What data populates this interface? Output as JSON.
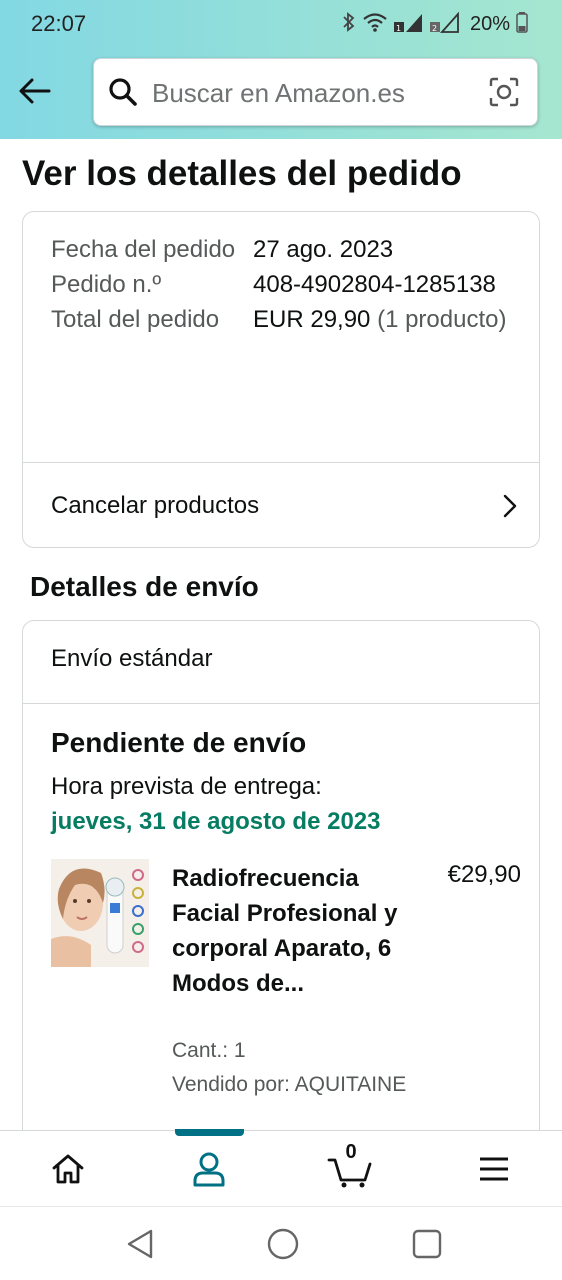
{
  "status_bar": {
    "time": "22:07",
    "battery": "20%"
  },
  "search": {
    "placeholder": "Buscar en Amazon.es"
  },
  "page": {
    "title": "Ver los detalles del pedido"
  },
  "order": {
    "date_label": "Fecha del pedido",
    "date_value": "27 ago. 2023",
    "number_label": "Pedido n.º",
    "number_value": "408-4902804-1285138",
    "total_label": "Total del pedido",
    "total_value": "EUR 29,90",
    "total_note": "(1 producto)",
    "cancel_label": "Cancelar productos"
  },
  "shipping": {
    "section_title": "Detalles de envío",
    "method": "Envío estándar",
    "status": "Pendiente de envío",
    "eta_label": "Hora prevista de entrega:",
    "eta_date": "jueves, 31 de agosto de 2023",
    "accent_color": "#067d62"
  },
  "product": {
    "name": "Radiofrecuencia Facial Profesional y corporal Aparato, 6 Modos de...",
    "price": "€29,90",
    "quantity": "Cant.: 1",
    "seller": "Vendido por: AQUITAINE"
  },
  "bottom_nav": {
    "items": [
      "home-icon",
      "account-icon",
      "cart-icon",
      "menu-icon"
    ],
    "active": "account-icon",
    "cart_count": "0",
    "active_color": "#007185"
  },
  "system_nav": {
    "buttons": [
      "back",
      "home",
      "recents"
    ]
  }
}
